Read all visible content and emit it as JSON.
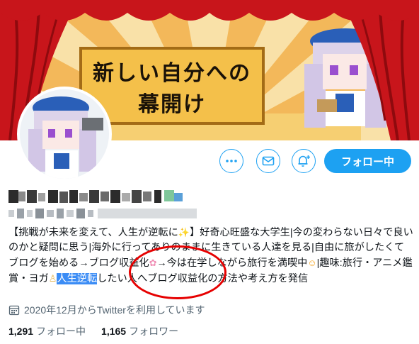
{
  "banner": {
    "title_line1": "新しい自分への",
    "title_line2": "幕開け"
  },
  "actions": {
    "more_icon": "more-dots-icon",
    "message_icon": "mail-icon",
    "notify_icon": "bell-plus-icon",
    "follow_label": "フォロー中"
  },
  "profile": {
    "bio_part1": "【挑戦が未来を変えて、人生が逆転に",
    "bio_part2": "】好奇心旺盛な大学生|今の変わらない日々で良いのかと疑問に思う|海外に行ってありのままに生きている人達を見る|自由に旅がしたくてブログを始める→ブログ収益化",
    "bio_part3": "→今は在学しながら旅行を満喫中",
    "bio_part4": "|趣味:旅行・アニメ鑑賞・ヨガ",
    "bio_highlight": "人生逆転",
    "bio_part5": "したい人へブログ収益化の方法や考え方を発信",
    "joined": "2020年12月からTwitterを利用しています",
    "following_count": "1,291",
    "following_label": "フォロー中",
    "followers_count": "1,165",
    "followers_label": "フォロワー"
  },
  "colors": {
    "accent": "#1da1f2",
    "highlight": "#3b8cf5",
    "annotation": "#e60000",
    "curtain": "#c8151b"
  }
}
